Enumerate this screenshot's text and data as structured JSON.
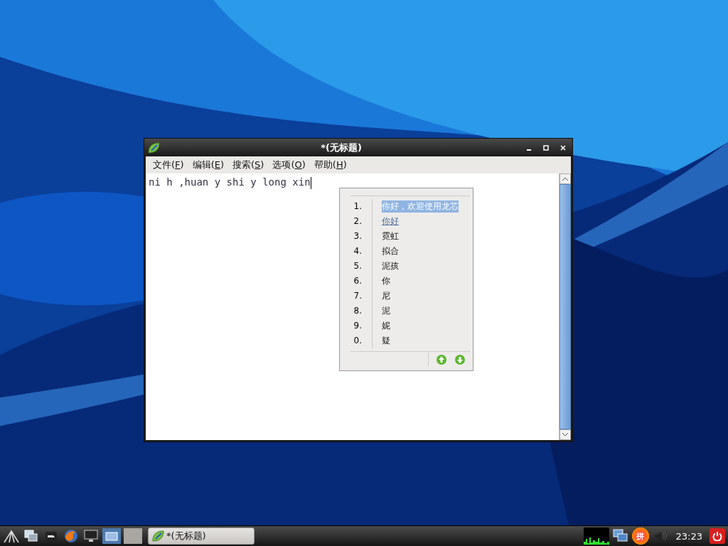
{
  "window": {
    "title": "*(无标题)",
    "menu": [
      {
        "label": "文件(F)"
      },
      {
        "label": "编辑(E)"
      },
      {
        "label": "搜索(S)"
      },
      {
        "label": "选项(O)"
      },
      {
        "label": "帮助(H)"
      }
    ],
    "editor_text": "ni h ,huan y shi y long xin"
  },
  "candidate_popup": {
    "candidates": [
      {
        "index": "1.",
        "text": "你好，欢迎使用龙芯",
        "selected": true,
        "hovered": false
      },
      {
        "index": "2.",
        "text": "你好",
        "selected": false,
        "hovered": true
      },
      {
        "index": "3.",
        "text": "霓虹",
        "selected": false,
        "hovered": false
      },
      {
        "index": "4.",
        "text": "拟合",
        "selected": false,
        "hovered": false
      },
      {
        "index": "5.",
        "text": "泥孩",
        "selected": false,
        "hovered": false
      },
      {
        "index": "6.",
        "text": "你",
        "selected": false,
        "hovered": false
      },
      {
        "index": "7.",
        "text": "尼",
        "selected": false,
        "hovered": false
      },
      {
        "index": "8.",
        "text": "泥",
        "selected": false,
        "hovered": false
      },
      {
        "index": "9.",
        "text": "妮",
        "selected": false,
        "hovered": false
      },
      {
        "index": "0.",
        "text": "疑",
        "selected": false,
        "hovered": false
      }
    ]
  },
  "taskbar": {
    "desktops": [
      {
        "selected": true
      },
      {
        "selected": false
      }
    ],
    "tasks": [
      {
        "label": "*(无标题)"
      }
    ],
    "ime_label": "拼",
    "clock": "23:23"
  }
}
